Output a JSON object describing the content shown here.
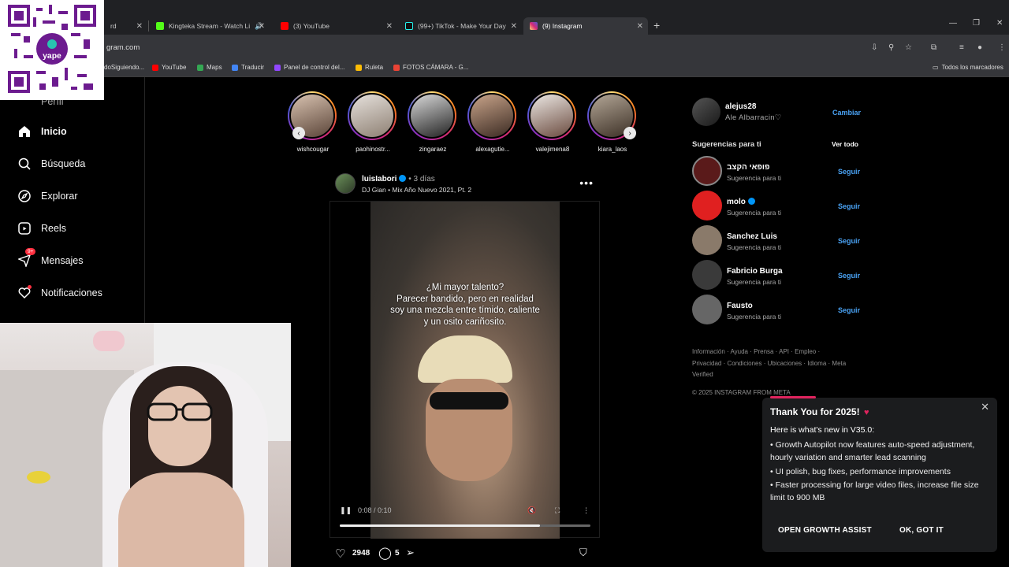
{
  "browser": {
    "tabs": [
      {
        "title": "rd",
        "favicon_color": "#444"
      },
      {
        "title": "Kingteka Stream - Watch Li",
        "favicon_color": "#53fc18"
      },
      {
        "title": "(3) YouTube",
        "favicon_color": "#ff0000"
      },
      {
        "title": "(99+) TikTok - Make Your Day",
        "favicon_color": "#111111"
      },
      {
        "title": "(9) Instagram",
        "favicon_color": "#e1306c"
      }
    ],
    "url": "gram.com",
    "bookmarks": [
      {
        "label": "doSiguiendo...",
        "color": "#888888"
      },
      {
        "label": "YouTube",
        "color": "#ff0000"
      },
      {
        "label": "Maps",
        "color": "#34a853"
      },
      {
        "label": "Traducir",
        "color": "#4285f4"
      },
      {
        "label": "Panel de control del...",
        "color": "#9147ff"
      },
      {
        "label": "Ruleta",
        "color": "#fbbc05"
      },
      {
        "label": "FOTOS CÁMARA - G...",
        "color": "#ea4335"
      }
    ],
    "all_bookmarks": "Todos los marcadores"
  },
  "nav": {
    "partial_top": "Perfil",
    "items": [
      {
        "label": "Inicio",
        "icon": "home-icon"
      },
      {
        "label": "Búsqueda",
        "icon": "search-icon"
      },
      {
        "label": "Explorar",
        "icon": "compass-icon"
      },
      {
        "label": "Reels",
        "icon": "reels-icon"
      },
      {
        "label": "Mensajes",
        "icon": "messenger-icon",
        "badge": "9+"
      },
      {
        "label": "Notificaciones",
        "icon": "heart-icon"
      }
    ]
  },
  "stories": [
    "wishcougar",
    "paohinostr...",
    "zingaraez",
    "alexagutie...",
    "valejimena8",
    "kiara_laos"
  ],
  "post": {
    "username": "luisIabori",
    "time": "3 días",
    "music": "DJ Gian • Mix Año Nuevo 2021, Pt. 2",
    "caption_lines": [
      "¿Mi mayor talento?",
      "Parecer bandido, pero en realidad",
      "soy una mezcla entre tímido, caliente",
      "y un osito cariñosito."
    ],
    "video_time": "0:08 / 0:10",
    "progress": 0.8,
    "likes": "2948",
    "comments": "5"
  },
  "sidebar": {
    "me_username": "alejus28",
    "me_name": "Ale Albarracin♡",
    "switch_label": "Cambiar",
    "suggestions_title": "Sugerencias para ti",
    "see_all": "Ver todo",
    "follow_label": "Seguir",
    "suggestions": [
      {
        "name": "פופאי הקצב",
        "sub": "Sugerencia para ti",
        "verified": false,
        "color": "#5a1a1a"
      },
      {
        "name": "molo",
        "sub": "Sugerencia para ti",
        "verified": true,
        "color": "#e02020"
      },
      {
        "name": "Sanchez Luis",
        "sub": "Sugerencia para ti",
        "verified": false,
        "color": "#8a7a6a"
      },
      {
        "name": "Fabricio Burga",
        "sub": "Sugerencia para ti",
        "verified": false,
        "color": "#3a3a3a"
      },
      {
        "name": "Fausto",
        "sub": "Sugerencia para ti",
        "verified": false,
        "color": "#666666"
      }
    ],
    "footer_links": "Información · Ayuda · Prensa · API · Empleo · Privacidad · Condiciones · Ubicaciones · Idioma · Meta Verified",
    "copyright": "© 2025 INSTAGRAM FROM META"
  },
  "popup": {
    "title": "Thank You for 2025!",
    "subtitle": "Here is what's new in V35.0:",
    "items": [
      "• Growth Autopilot now features auto-speed adjustment, hourly variation and smarter lead scanning",
      "• UI polish, bug fixes, performance improvements",
      "• Faster processing for large video files, increase file size limit to 900 MB"
    ],
    "primary_button": "OPEN GROWTH ASSIST",
    "secondary_button": "OK, GOT IT"
  },
  "overlay": {
    "qr_brand": "yape"
  }
}
